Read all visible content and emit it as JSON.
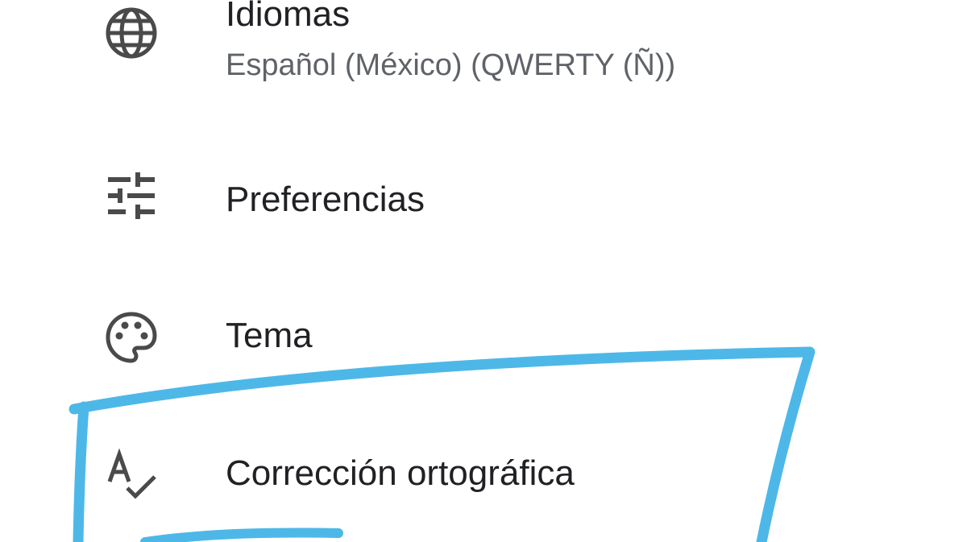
{
  "settings": {
    "items": [
      {
        "title": "Idiomas",
        "subtitle": "Español (México) (QWERTY (Ñ))",
        "icon": "globe-icon"
      },
      {
        "title": "Preferencias",
        "icon": "tune-icon"
      },
      {
        "title": "Tema",
        "icon": "palette-icon"
      },
      {
        "title": "Corrección ortográfica",
        "icon": "spellcheck-icon"
      }
    ]
  },
  "colors": {
    "icon": "#4a4a4a",
    "title_text": "#202124",
    "subtitle_text": "#5f6368",
    "annotation_stroke": "#4db8e8",
    "background": "#ffffff"
  }
}
